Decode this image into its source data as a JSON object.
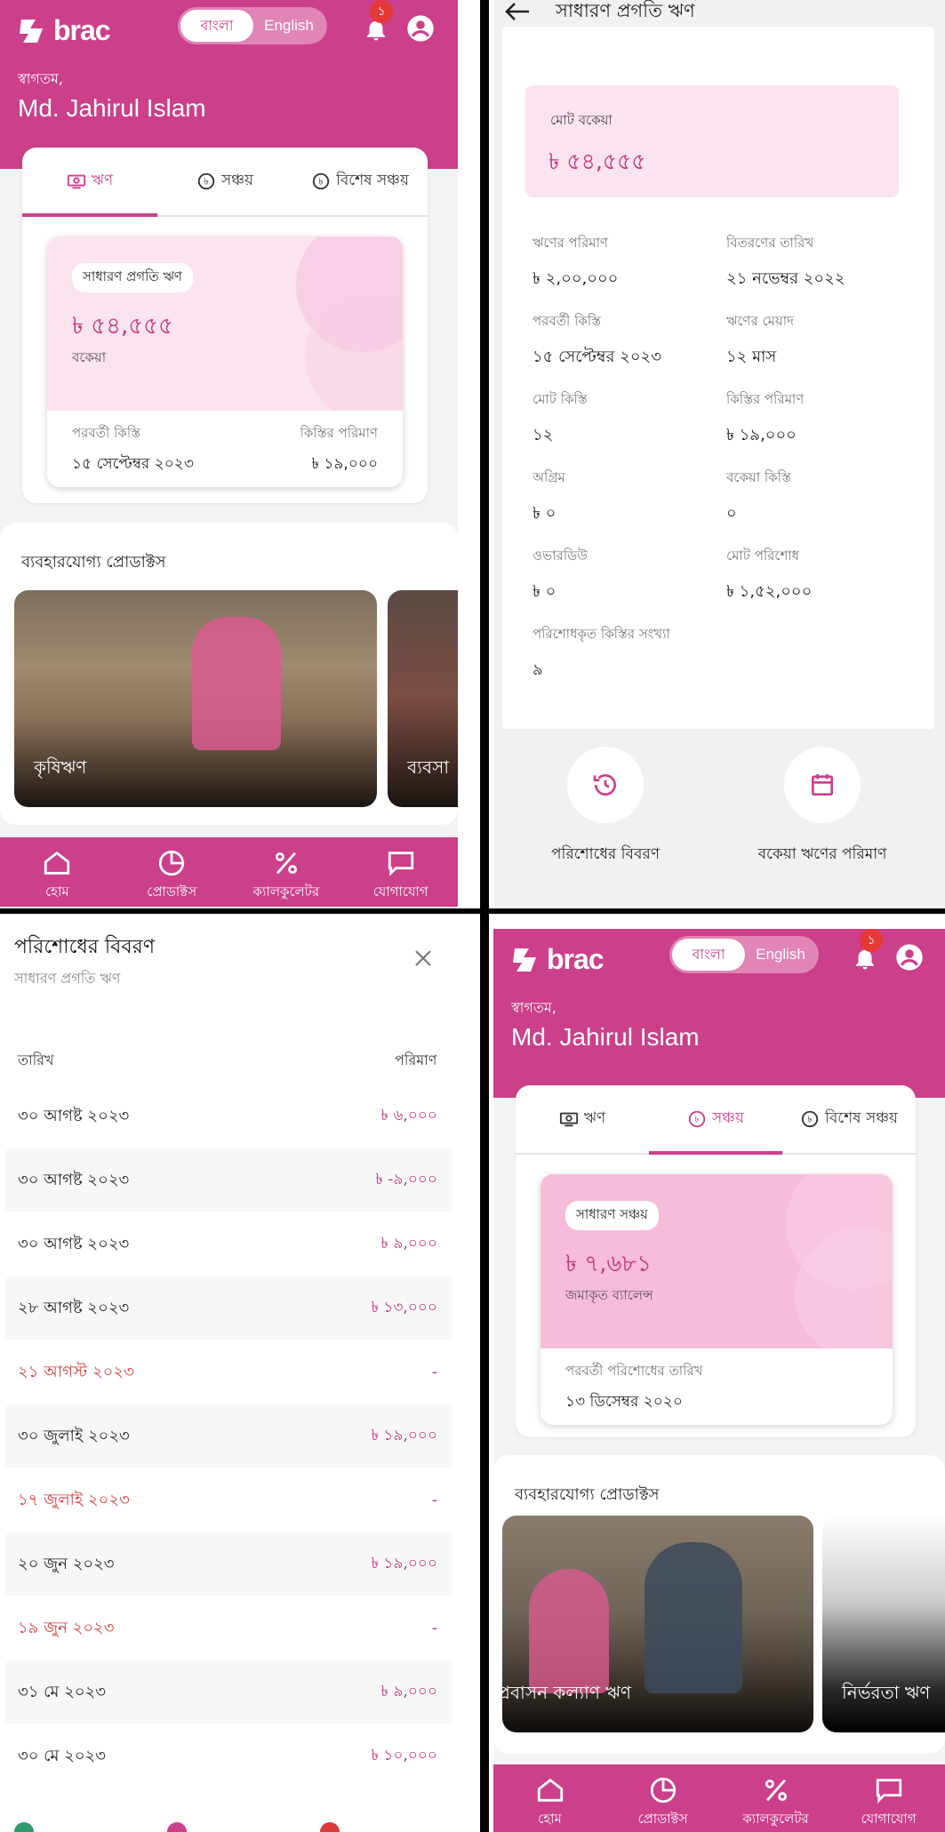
{
  "colors": {
    "brand": "#cc3f8a",
    "brand_text": "#c0397e",
    "pink_light": "#fbe3ef",
    "missed": "#d93a3a",
    "badge": "#e53935"
  },
  "home_loan": {
    "brand": "brac",
    "lang_bn": "বাংলা",
    "lang_en": "English",
    "notif_count": "১",
    "greeting": "স্বাগতম,",
    "user_name": "Md. Jahirul Islam",
    "tabs": [
      "ঋণ",
      "সঞ্চয়",
      "বিশেষ সঞ্চয়"
    ],
    "active_tab": 0,
    "card": {
      "chip": "সাধারণ প্রগতি ঋণ",
      "amount": "৳ ৫৪,৫৫৫",
      "amount_label": "বকেয়া",
      "left_label": "পরবর্তী কিস্তি",
      "left_value": "১৫ সেপ্টেম্বর ২০২৩",
      "right_label": "কিস্তির পরিমাণ",
      "right_value": "৳ ১৯,০০০"
    },
    "products_title": "ব্যবহারযোগ্য প্রোডাক্টস",
    "products": [
      "কৃষিঋণ",
      "ব্যবসা"
    ],
    "nav": [
      "হোম",
      "প্রোডাক্টস",
      "ক্যালকুলেটর",
      "যোগাযোগ"
    ]
  },
  "loan_detail": {
    "title": "সাধারণ প্রগতি ঋণ",
    "total_label": "মোট বকেয়া",
    "total_value": "৳ ৫৪,৫৫৫",
    "fields": [
      {
        "label": "ঋণের পরিমাণ",
        "value": "৳ ২,০০,০০০"
      },
      {
        "label": "বিতরণের তারিখ",
        "value": "২১ নভেম্বর ২০২২"
      },
      {
        "label": "পরবর্তী কিস্তি",
        "value": "১৫ সেপ্টেম্বর ২০২৩"
      },
      {
        "label": "ঋণের মেয়াদ",
        "value": "১২ মাস"
      },
      {
        "label": "মোট কিস্তি",
        "value": "১২"
      },
      {
        "label": "কিস্তির পরিমাণ",
        "value": "৳ ১৯,০০০"
      },
      {
        "label": "অগ্রিম",
        "value": "৳ ০"
      },
      {
        "label": "বকেয়া কিস্তি",
        "value": "০"
      },
      {
        "label": "ওভারডিউ",
        "value": "৳ ০"
      },
      {
        "label": "মোট পরিশোধ",
        "value": "৳ ১,৫২,০০০"
      },
      {
        "label": "পরিশোধকৃত কিস্তির সংখ্যা",
        "value": "৯"
      }
    ],
    "actions": [
      "পরিশোধের বিবরণ",
      "বকেয়া ঋণের পরিমাণ"
    ]
  },
  "history": {
    "title": "পরিশোধের বিবরণ",
    "subtitle": "সাধারণ প্রগতি ঋণ",
    "col_date": "তারিখ",
    "col_amount": "পরিমাণ",
    "rows": [
      {
        "date": "৩০ আগষ্ট ২০২৩",
        "amount": "৳ ৬,০০০",
        "missed": false
      },
      {
        "date": "৩০ আগষ্ট ২০২৩",
        "amount": "৳ -৯,০০০",
        "missed": false
      },
      {
        "date": "৩০ আগষ্ট ২০২৩",
        "amount": "৳ ৯,০০০",
        "missed": false
      },
      {
        "date": "২৮ আগষ্ট ২০২৩",
        "amount": "৳ ১৩,০০০",
        "missed": false
      },
      {
        "date": "২১ আগস্ট ২০২৩",
        "amount": "-",
        "missed": true
      },
      {
        "date": "৩০ জুলাই ২০২৩",
        "amount": "৳ ১৯,০০০",
        "missed": false
      },
      {
        "date": "১৭ জুলাই ২০২৩",
        "amount": "-",
        "missed": true
      },
      {
        "date": "২০ জুন ২০২৩",
        "amount": "৳ ১৯,০০০",
        "missed": false
      },
      {
        "date": "১৯ জুন ২০২৩",
        "amount": "-",
        "missed": true
      },
      {
        "date": "৩১ মে ২০২৩",
        "amount": "৳ ৯,০০০",
        "missed": false
      },
      {
        "date": "৩০ মে ২০২৩",
        "amount": "৳ ১০,০০০",
        "missed": false
      }
    ]
  },
  "home_savings": {
    "brand": "brac",
    "lang_bn": "বাংলা",
    "lang_en": "English",
    "notif_count": "১",
    "greeting": "স্বাগতম,",
    "user_name": "Md. Jahirul Islam",
    "tabs": [
      "ঋণ",
      "সঞ্চয়",
      "বিশেষ সঞ্চয়"
    ],
    "active_tab": 1,
    "card": {
      "chip": "সাধারণ সঞ্চয়",
      "amount": "৳ ৭,৬৮১",
      "amount_label": "জমাকৃত ব্যালেন্স",
      "left_label": "পরবর্তী পরিশোধের তারিখ",
      "left_value": "১৩ ডিসেম্বর ২০২০"
    },
    "products_title": "ব্যবহারযোগ্য প্রোডাক্টস",
    "products": [
      "প্রবাসন কল্যাণ ঋণ",
      "নির্ভরতা ঋণ"
    ],
    "nav": [
      "হোম",
      "প্রোডাক্টস",
      "ক্যালকুলেটর",
      "যোগাযোগ"
    ]
  }
}
